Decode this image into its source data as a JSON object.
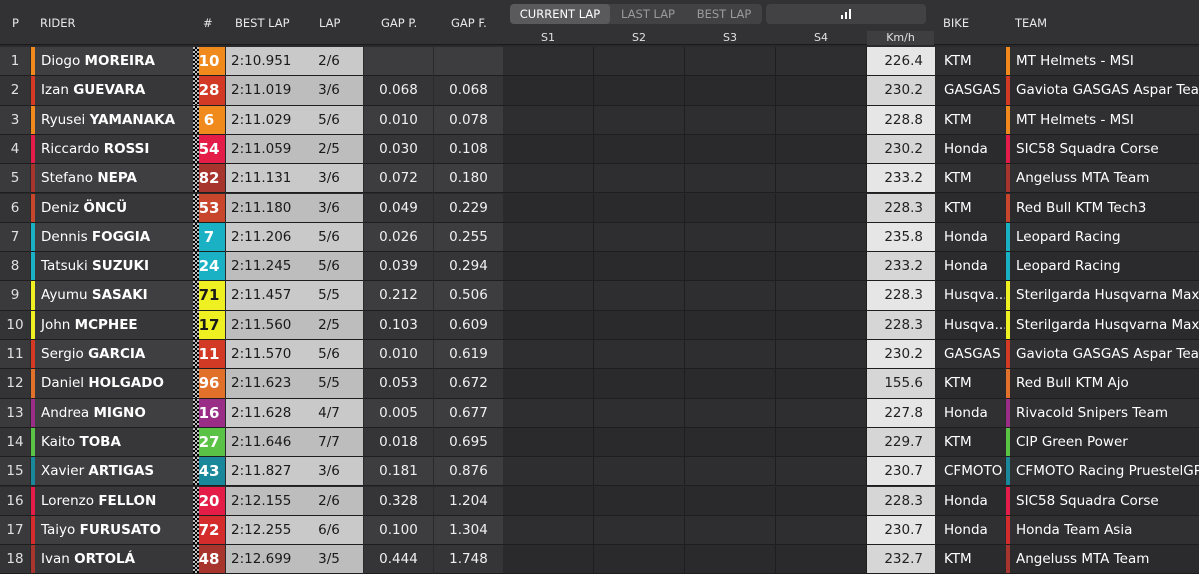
{
  "header": {
    "pos": "P",
    "rider": "RIDER",
    "number": "#",
    "best_lap": "BEST LAP",
    "lap": "LAP",
    "gap_p": "GAP P.",
    "gap_f": "GAP F.",
    "tabs": [
      "CURRENT LAP",
      "LAST LAP",
      "BEST LAP"
    ],
    "active_tab": "CURRENT LAP",
    "chart_icon": "bar-chart-icon",
    "sectors": [
      "S1",
      "S2",
      "S3",
      "S4"
    ],
    "speed": "Km/h",
    "bike": "BIKE",
    "team": "TEAM"
  },
  "riders": [
    {
      "pos": "1",
      "first": "Diogo",
      "last": "MOREIRA",
      "num": "10",
      "color": "#f08a1c",
      "best": "2:10.951",
      "lap": "2/6",
      "gap_p": "",
      "gap_f": "",
      "speed": "226.4",
      "bike": "KTM",
      "team": "MT Helmets - MSI"
    },
    {
      "pos": "2",
      "first": "Izan",
      "last": "GUEVARA",
      "num": "28",
      "color": "#d23a26",
      "best": "2:11.019",
      "lap": "3/6",
      "gap_p": "0.068",
      "gap_f": "0.068",
      "speed": "230.2",
      "bike": "GASGAS",
      "team": "Gaviota GASGAS Aspar Team"
    },
    {
      "pos": "3",
      "first": "Ryusei",
      "last": "YAMANAKA",
      "num": "6",
      "color": "#f08a1c",
      "best": "2:11.029",
      "lap": "5/6",
      "gap_p": "0.010",
      "gap_f": "0.078",
      "speed": "228.8",
      "bike": "KTM",
      "team": "MT Helmets - MSI"
    },
    {
      "pos": "4",
      "first": "Riccardo",
      "last": "ROSSI",
      "num": "54",
      "color": "#e31d48",
      "best": "2:11.059",
      "lap": "2/5",
      "gap_p": "0.030",
      "gap_f": "0.108",
      "speed": "230.2",
      "bike": "Honda",
      "team": "SIC58 Squadra Corse"
    },
    {
      "pos": "5",
      "first": "Stefano",
      "last": "NEPA",
      "num": "82",
      "color": "#a8342e",
      "best": "2:11.131",
      "lap": "3/6",
      "gap_p": "0.072",
      "gap_f": "0.180",
      "speed": "233.2",
      "bike": "KTM",
      "team": "Angeluss MTA Team"
    },
    {
      "pos": "6",
      "first": "Deniz",
      "last": "ÖNCÜ",
      "num": "53",
      "color": "#c7462c",
      "best": "2:11.180",
      "lap": "3/6",
      "gap_p": "0.049",
      "gap_f": "0.229",
      "speed": "228.3",
      "bike": "KTM",
      "team": "Red Bull KTM Tech3"
    },
    {
      "pos": "7",
      "first": "Dennis",
      "last": "FOGGIA",
      "num": "7",
      "color": "#1ab1c4",
      "best": "2:11.206",
      "lap": "5/6",
      "gap_p": "0.026",
      "gap_f": "0.255",
      "speed": "235.8",
      "bike": "Honda",
      "team": "Leopard Racing"
    },
    {
      "pos": "8",
      "first": "Tatsuki",
      "last": "SUZUKI",
      "num": "24",
      "color": "#1ab1c4",
      "best": "2:11.245",
      "lap": "5/6",
      "gap_p": "0.039",
      "gap_f": "0.294",
      "speed": "233.2",
      "bike": "Honda",
      "team": "Leopard Racing"
    },
    {
      "pos": "9",
      "first": "Ayumu",
      "last": "SASAKI",
      "num": "71",
      "color": "#eef021",
      "best": "2:11.457",
      "lap": "5/5",
      "gap_p": "0.212",
      "gap_f": "0.506",
      "speed": "228.3",
      "bike": "Husqva...",
      "team": "Sterilgarda Husqvarna Max"
    },
    {
      "pos": "10",
      "first": "John",
      "last": "MCPHEE",
      "num": "17",
      "color": "#eef021",
      "best": "2:11.560",
      "lap": "2/5",
      "gap_p": "0.103",
      "gap_f": "0.609",
      "speed": "228.3",
      "bike": "Husqva...",
      "team": "Sterilgarda Husqvarna Max"
    },
    {
      "pos": "11",
      "first": "Sergio",
      "last": "GARCIA",
      "num": "11",
      "color": "#d23a26",
      "best": "2:11.570",
      "lap": "5/6",
      "gap_p": "0.010",
      "gap_f": "0.619",
      "speed": "230.2",
      "bike": "GASGAS",
      "team": "Gaviota GASGAS Aspar Team"
    },
    {
      "pos": "12",
      "first": "Daniel",
      "last": "HOLGADO",
      "num": "96",
      "color": "#e0702a",
      "best": "2:11.623",
      "lap": "5/5",
      "gap_p": "0.053",
      "gap_f": "0.672",
      "speed": "155.6",
      "bike": "KTM",
      "team": "Red Bull KTM Ajo"
    },
    {
      "pos": "13",
      "first": "Andrea",
      "last": "MIGNO",
      "num": "16",
      "color": "#9a2e86",
      "best": "2:11.628",
      "lap": "4/7",
      "gap_p": "0.005",
      "gap_f": "0.677",
      "speed": "227.8",
      "bike": "Honda",
      "team": "Rivacold Snipers Team"
    },
    {
      "pos": "14",
      "first": "Kaito",
      "last": "TOBA",
      "num": "27",
      "color": "#5ac244",
      "best": "2:11.646",
      "lap": "7/7",
      "gap_p": "0.018",
      "gap_f": "0.695",
      "speed": "229.7",
      "bike": "KTM",
      "team": "CIP Green Power"
    },
    {
      "pos": "15",
      "first": "Xavier",
      "last": "ARTIGAS",
      "num": "43",
      "color": "#19889a",
      "best": "2:11.827",
      "lap": "3/6",
      "gap_p": "0.181",
      "gap_f": "0.876",
      "speed": "230.7",
      "bike": "CFMOTO",
      "team": "CFMOTO Racing PruestelGP"
    },
    {
      "pos": "16",
      "first": "Lorenzo",
      "last": "FELLON",
      "num": "20",
      "color": "#e31d48",
      "best": "2:12.155",
      "lap": "2/6",
      "gap_p": "0.328",
      "gap_f": "1.204",
      "speed": "228.3",
      "bike": "Honda",
      "team": "SIC58 Squadra Corse"
    },
    {
      "pos": "17",
      "first": "Taiyo",
      "last": "FURUSATO",
      "num": "72",
      "color": "#d42c2c",
      "best": "2:12.255",
      "lap": "6/6",
      "gap_p": "0.100",
      "gap_f": "1.304",
      "speed": "230.7",
      "bike": "Honda",
      "team": "Honda Team Asia"
    },
    {
      "pos": "18",
      "first": "Ivan",
      "last": "ORTOLÁ",
      "num": "48",
      "color": "#a8342e",
      "best": "2:12.699",
      "lap": "3/5",
      "gap_p": "0.444",
      "gap_f": "1.748",
      "speed": "232.7",
      "bike": "KTM",
      "team": "Angeluss MTA Team"
    }
  ]
}
